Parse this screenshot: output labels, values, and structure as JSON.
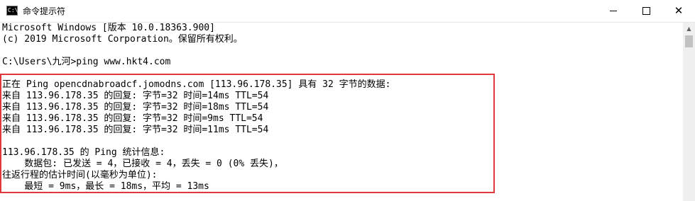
{
  "window": {
    "title": "命令提示符",
    "icon": "cmd-icon",
    "icon_text": "C:\\",
    "controls": {
      "minimize": "minimize-icon",
      "maximize": "maximize-icon",
      "close": "close-icon",
      "close_glyph": "✕"
    }
  },
  "console": {
    "lines": [
      "Microsoft Windows [版本 10.0.18363.900]",
      "(c) 2019 Microsoft Corporation。保留所有权利。",
      "",
      "C:\\Users\\九河>ping www.hkt4.com",
      "",
      "正在 Ping opencdnabroadcf.jomodns.com [113.96.178.35] 具有 32 字节的数据:",
      "来自 113.96.178.35 的回复: 字节=32 时间=14ms TTL=54",
      "来自 113.96.178.35 的回复: 字节=32 时间=18ms TTL=54",
      "来自 113.96.178.35 的回复: 字节=32 时间=9ms TTL=54",
      "来自 113.96.178.35 的回复: 字节=32 时间=11ms TTL=54",
      "",
      "113.96.178.35 的 Ping 统计信息:",
      "    数据包: 已发送 = 4，已接收 = 4，丢失 = 0 (0% 丢失)，",
      "往返行程的估计时间(以毫秒为单位):",
      "    最短 = 9ms，最长 = 18ms，平均 = 13ms"
    ]
  },
  "highlight_color": "#e0383b",
  "scrollbar": {
    "up_arrow": "▲"
  }
}
